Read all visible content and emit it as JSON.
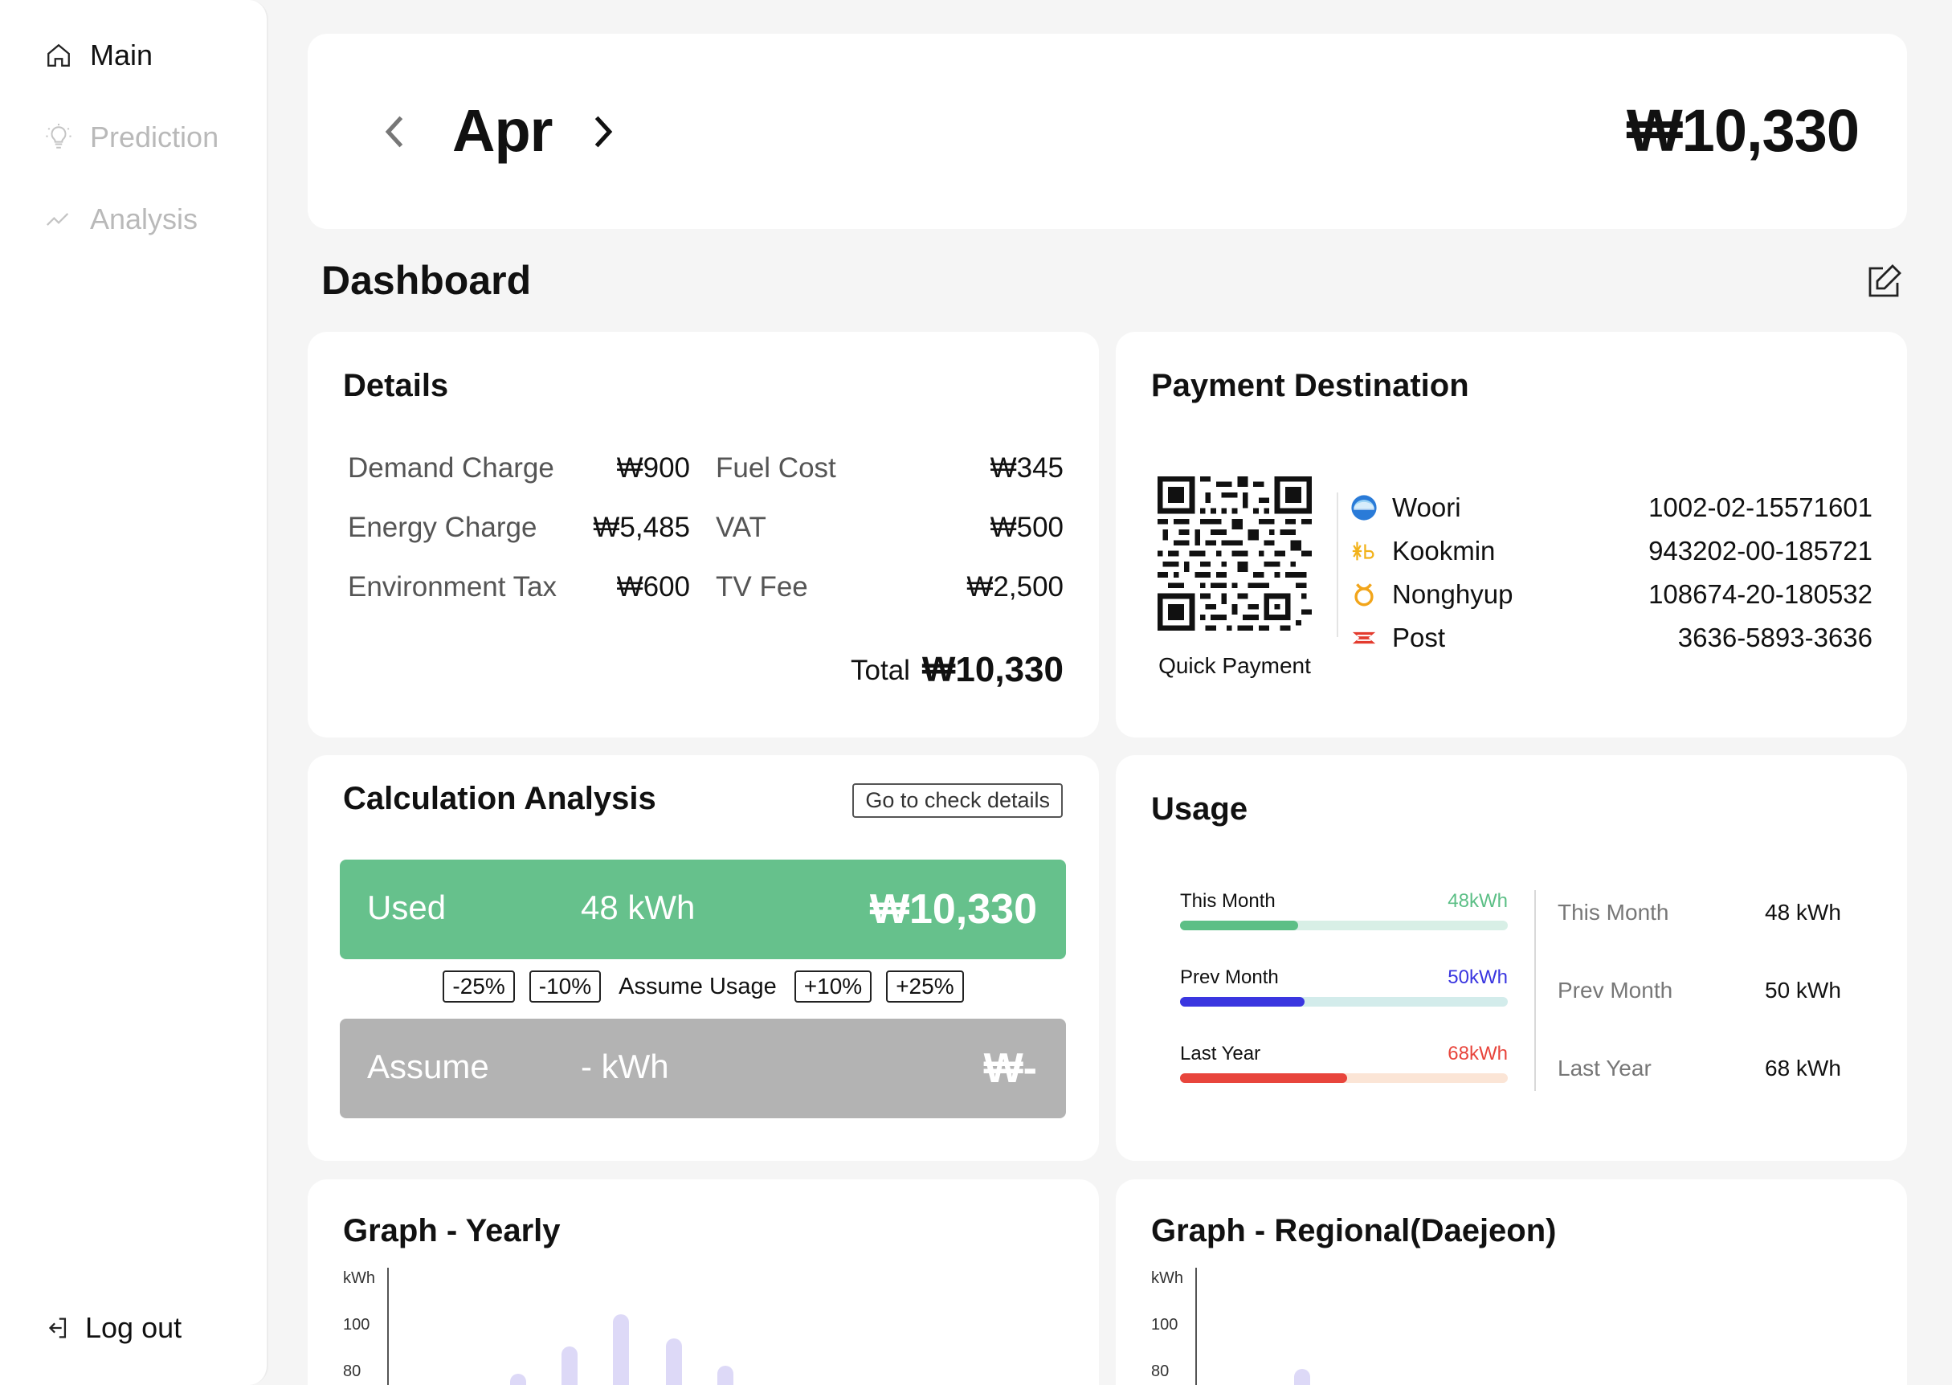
{
  "sidebar": {
    "items": [
      {
        "label": "Main",
        "icon": "home-icon",
        "active": true
      },
      {
        "label": "Prediction",
        "icon": "lightbulb-icon",
        "active": false
      },
      {
        "label": "Analysis",
        "icon": "trend-line-icon",
        "active": false
      }
    ],
    "logout_label": "Log out"
  },
  "header": {
    "month": "Apr",
    "total": "₩10,330"
  },
  "dashboard": {
    "title": "Dashboard"
  },
  "details": {
    "title": "Details",
    "left": [
      {
        "label": "Demand Charge",
        "value": "₩900"
      },
      {
        "label": "Energy Charge",
        "value": "₩5,485"
      },
      {
        "label": "Environment Tax",
        "value": "₩600"
      }
    ],
    "right": [
      {
        "label": "Fuel Cost",
        "value": "₩345"
      },
      {
        "label": "VAT",
        "value": "₩500"
      },
      {
        "label": "TV Fee",
        "value": "₩2,500"
      }
    ],
    "total_label": "Total",
    "total_value": "₩10,330"
  },
  "payment": {
    "title": "Payment Destination",
    "qr_label": "Quick Payment",
    "banks": [
      {
        "name": "Woori",
        "account": "1002-02-15571601",
        "icon": "woori-bank-icon"
      },
      {
        "name": "Kookmin",
        "account": "943202-00-185721",
        "icon": "kookmin-bank-icon"
      },
      {
        "name": "Nonghyup",
        "account": "108674-20-180532",
        "icon": "nonghyup-bank-icon"
      },
      {
        "name": "Post",
        "account": "3636-5893-3636",
        "icon": "post-bank-icon"
      }
    ]
  },
  "calc": {
    "title": "Calculation Analysis",
    "check_details": "Go to check details",
    "used": {
      "label": "Used",
      "kwh": "48 kWh",
      "cost": "₩10,330"
    },
    "assume": {
      "label": "Assume",
      "kwh": "- kWh",
      "cost": "₩-"
    },
    "adjust": {
      "minus25": "-25%",
      "minus10": "-10%",
      "label": "Assume Usage",
      "plus10": "+10%",
      "plus25": "+25%"
    }
  },
  "usage": {
    "title": "Usage",
    "bars": [
      {
        "name": "This Month",
        "value_label": "48kWh",
        "fraction": 0.36,
        "color": "#5cbf86",
        "value_color": "#5cbf86",
        "track": "#d8efe6"
      },
      {
        "name": "Prev Month",
        "value_label": "50kWh",
        "fraction": 0.38,
        "color": "#3a36e0",
        "value_color": "#3a36e0",
        "track": "#d3eceb"
      },
      {
        "name": "Last Year",
        "value_label": "68kWh",
        "fraction": 0.51,
        "color": "#e8453c",
        "value_color": "#e8453c",
        "track": "#fbe5d6"
      }
    ],
    "summary": [
      {
        "label": "This Month",
        "value": "48 kWh"
      },
      {
        "label": "Prev Month",
        "value": "50 kWh"
      },
      {
        "label": "Last Year",
        "value": "68 kWh"
      }
    ]
  },
  "graphs": {
    "yearly": {
      "title": "Graph - Yearly",
      "unit": "kWh",
      "ticks": [
        "100",
        "80"
      ]
    },
    "regional": {
      "title": "Graph - Regional(Daejeon)",
      "unit": "kWh",
      "ticks": [
        "100",
        "80"
      ]
    }
  }
}
